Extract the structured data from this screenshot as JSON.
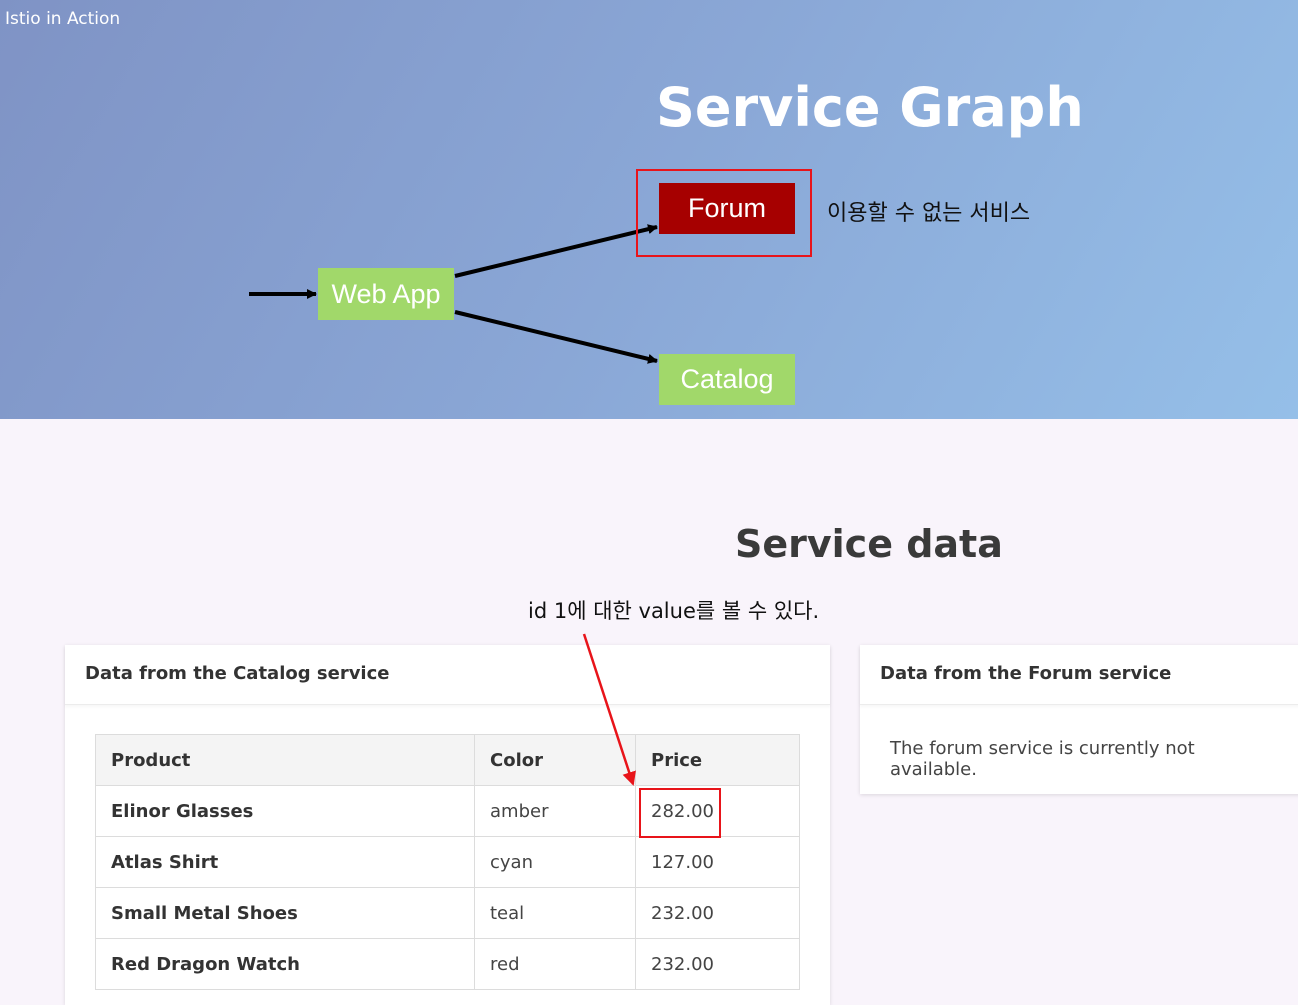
{
  "header": {
    "brand": "Istio in Action"
  },
  "hero": {
    "title": "Service Graph",
    "nodes": {
      "web_app": "Web App",
      "forum": "Forum",
      "catalog": "Catalog"
    },
    "forum_note": "이용할 수 없는 서비스"
  },
  "service_data": {
    "title": "Service data",
    "annotation": "id 1에 대한 value를 볼 수 있다.",
    "catalog": {
      "header": "Data from the Catalog service",
      "columns": [
        "Product",
        "Color",
        "Price"
      ],
      "rows": [
        {
          "product": "Elinor Glasses",
          "color": "amber",
          "price": "282.00"
        },
        {
          "product": "Atlas Shirt",
          "color": "cyan",
          "price": "127.00"
        },
        {
          "product": "Small Metal Shoes",
          "color": "teal",
          "price": "232.00"
        },
        {
          "product": "Red Dragon Watch",
          "color": "red",
          "price": "232.00"
        }
      ]
    },
    "forum": {
      "header": "Data from the Forum service",
      "message": "The forum service is currently not available."
    }
  },
  "colors": {
    "hero_start": "#7f93c5",
    "hero_end": "#95bfe8",
    "node_green": "#a1d86a",
    "node_red": "#a60000",
    "annotation_red": "#e8141a"
  }
}
